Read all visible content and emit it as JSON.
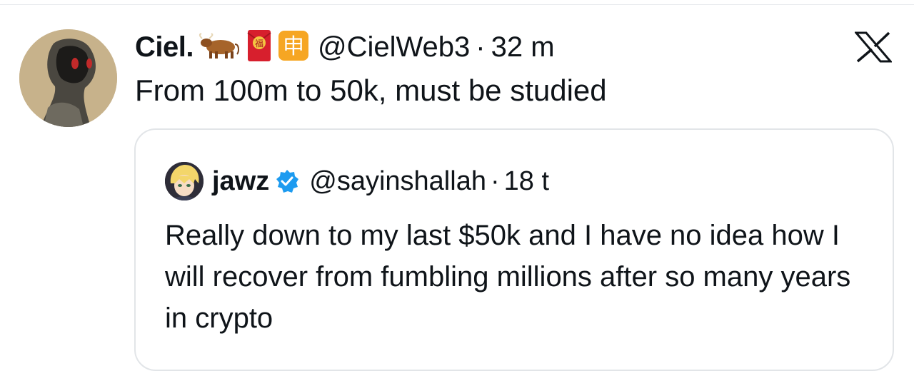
{
  "tweet": {
    "display_name": "Ciel.",
    "handle": "@CielWeb3",
    "time": "32 m",
    "separator": "·",
    "text": "From 100m to 50k, must be studied",
    "emoji": [
      "ox-emoji",
      "red-envelope-emoji",
      "ideograph-apply-emoji"
    ],
    "ideograph_char": "申",
    "envelope_char": "福"
  },
  "quote": {
    "display_name": "jawz",
    "handle": "@sayinshallah",
    "time": "18 t",
    "separator": "·",
    "text": "Really down to my last $50k and I have no idea how I will recover from fumbling millions after so many years in crypto",
    "verified": true
  },
  "colors": {
    "text": "#0f1419",
    "border": "#e2e5e8",
    "verified_blue": "#1d9bf0",
    "emoji_orange": "#f6a623",
    "envelope_red": "#d71f2d"
  },
  "icons": {
    "close": "x-logo-icon",
    "verified": "verified-badge-icon"
  }
}
